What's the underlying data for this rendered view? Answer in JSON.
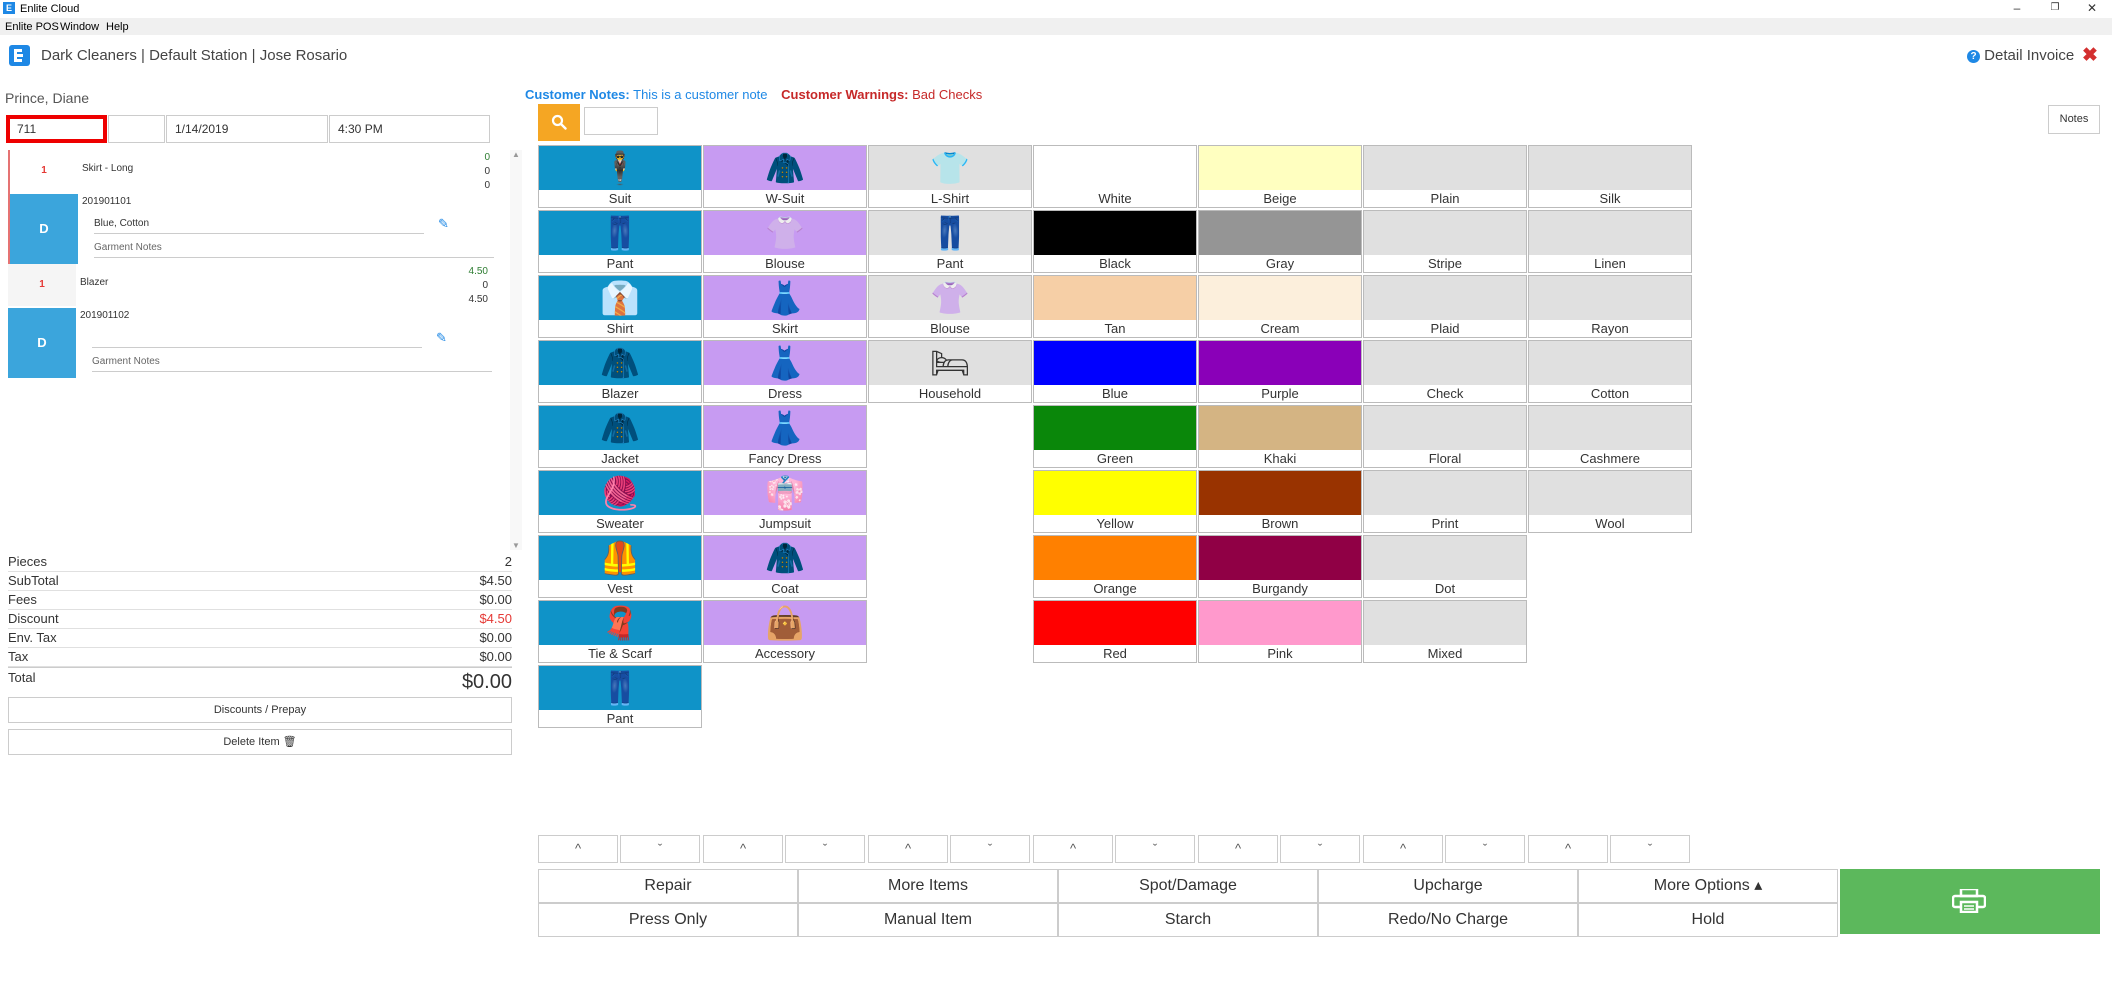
{
  "window": {
    "title": "Enlite Cloud",
    "logo_letter": "E",
    "controls": [
      "–",
      "❐",
      "✕"
    ],
    "menu": [
      "Enlite POS",
      "Window",
      "Help"
    ]
  },
  "header": {
    "title": "Dark Cleaners | Default Station | Jose Rosario",
    "info_label": "Detail Invoice",
    "close_icon": "✖"
  },
  "customer": {
    "name": "Prince, Diane",
    "ticket_number": "711",
    "date": "1/14/2019",
    "time": "4:30 PM",
    "notes_label": "Customer Notes:",
    "notes_text": "This is a customer note",
    "warnings_label": "Customer Warnings:",
    "warnings_text": "Bad Checks"
  },
  "items": [
    {
      "qty": "1",
      "name": "Skirt - Long",
      "nums": [
        "0",
        "0",
        "0"
      ],
      "type_letter": "D",
      "barcode": "201901101",
      "details": "Blue, Cotton",
      "notes_placeholder": "Garment Notes"
    },
    {
      "qty": "1",
      "name": "Blazer",
      "nums": [
        "4.50",
        "0",
        "4.50"
      ],
      "type_letter": "D",
      "barcode": "201901102",
      "details": "",
      "notes_placeholder": "Garment Notes"
    }
  ],
  "totals": {
    "rows": [
      {
        "label": "Pieces",
        "value": "2"
      },
      {
        "label": "SubTotal",
        "value": "$4.50"
      },
      {
        "label": "Fees",
        "value": "$0.00"
      },
      {
        "label": "Discount",
        "value": "$4.50"
      },
      {
        "label": "Env. Tax",
        "value": "$0.00"
      },
      {
        "label": "Tax",
        "value": "$0.00"
      }
    ],
    "total_label": "Total",
    "total_value": "$0.00",
    "discounts_button": "Discounts / Prepay",
    "delete_button": "Delete Item 🗑"
  },
  "toolbar": {
    "notes_button": "Notes",
    "search_icon": "search-icon"
  },
  "garments": {
    "column1": [
      {
        "label": "Suit",
        "icon": "🕴"
      },
      {
        "label": "Pant",
        "icon": "👖"
      },
      {
        "label": "Shirt",
        "icon": "👔"
      },
      {
        "label": "Blazer",
        "icon": "🧥"
      },
      {
        "label": "Jacket",
        "icon": "🧥"
      },
      {
        "label": "Sweater",
        "icon": "🧶"
      },
      {
        "label": "Vest",
        "icon": "🦺"
      },
      {
        "label": "Tie & Scarf",
        "icon": "🧣"
      },
      {
        "label": "Pant",
        "icon": "👖"
      }
    ],
    "column1_color": "#0f93c8",
    "column2": [
      {
        "label": "W-Suit",
        "icon": "🧥"
      },
      {
        "label": "Blouse",
        "icon": "👚"
      },
      {
        "label": "Skirt",
        "icon": "👗"
      },
      {
        "label": "Dress",
        "icon": "👗"
      },
      {
        "label": "Fancy Dress",
        "icon": "👗"
      },
      {
        "label": "Jumpsuit",
        "icon": "👘"
      },
      {
        "label": "Coat",
        "icon": "🧥"
      },
      {
        "label": "Accessory",
        "icon": "👜"
      }
    ],
    "column2_color": "#c79bf2",
    "column3": [
      {
        "label": "L-Shirt",
        "icon": "👕"
      },
      {
        "label": "Pant",
        "icon": "👖"
      },
      {
        "label": "Blouse",
        "icon": "👚"
      },
      {
        "label": "Household",
        "icon": "🛏"
      }
    ],
    "column3_color": "#e0e0e0"
  },
  "colors": [
    {
      "label": "White",
      "hex": "#ffffff"
    },
    {
      "label": "Black",
      "hex": "#000000"
    },
    {
      "label": "Tan",
      "hex": "#f6cfa6"
    },
    {
      "label": "Blue",
      "hex": "#0000ff"
    },
    {
      "label": "Green",
      "hex": "#0a870a"
    },
    {
      "label": "Yellow",
      "hex": "#ffff00"
    },
    {
      "label": "Orange",
      "hex": "#ff8000"
    },
    {
      "label": "Red",
      "hex": "#ff0000"
    },
    {
      "label": "Beige",
      "hex": "#ffffc0"
    },
    {
      "label": "Gray",
      "hex": "#959595"
    },
    {
      "label": "Cream",
      "hex": "#fcefdc"
    },
    {
      "label": "Purple",
      "hex": "#8a00b8"
    },
    {
      "label": "Khaki",
      "hex": "#d4b483"
    },
    {
      "label": "Brown",
      "hex": "#993300"
    },
    {
      "label": "Burgandy",
      "hex": "#900045"
    },
    {
      "label": "Pink",
      "hex": "#ff99cc"
    }
  ],
  "patterns": [
    "Plain",
    "Stripe",
    "Plaid",
    "Check",
    "Floral",
    "Print",
    "Dot",
    "Mixed"
  ],
  "fabrics": [
    "Silk",
    "Linen",
    "Rayon",
    "Cotton",
    "Cashmere",
    "Wool"
  ],
  "pattern_color": "#e0e0e0",
  "scroll_arrows": {
    "up": "^",
    "down": "ˇ"
  },
  "actions": {
    "row1": [
      "Repair",
      "More Items",
      "Spot/Damage",
      "Upcharge",
      "More Options ▴"
    ],
    "row2": [
      "Press Only",
      "Manual Item",
      "Starch",
      "Redo/No Charge",
      "Hold"
    ]
  },
  "print_button_color": "#5cb85c"
}
